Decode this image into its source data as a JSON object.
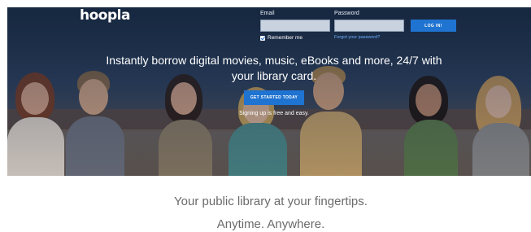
{
  "header": {
    "logo": "hoopla",
    "email_label": "Email",
    "password_label": "Password",
    "email_value": "",
    "password_value": "",
    "login_label": "LOG IN!",
    "remember_label": "Remember me",
    "remember_checked": true,
    "forgot_label": "Forgot your password?"
  },
  "hero": {
    "headline": "Instantly borrow digital movies, music, eBooks and more, 24/7 with your library card.",
    "cta_label": "GET STARTED TODAY",
    "signup_note": "Signing up is free and easy."
  },
  "tagline": {
    "line1": "Your public library at your fingertips.",
    "line2": "Anytime. Anywhere."
  },
  "colors": {
    "accent": "#1f73d1",
    "hero_dark": "#1c2c45",
    "text_muted": "#6a6a6a"
  }
}
